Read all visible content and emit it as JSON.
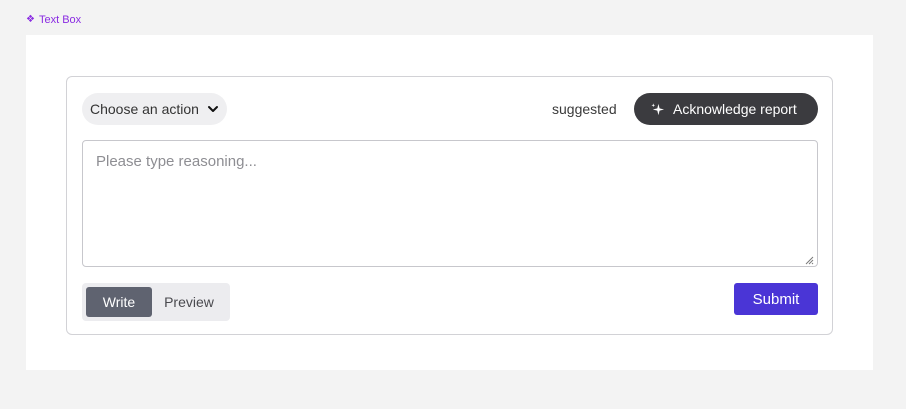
{
  "frame": {
    "label": "Text Box",
    "label_color": "#8a2be2"
  },
  "toolbar": {
    "action_select": {
      "selected": "Choose an action"
    },
    "suggested_label": "suggested",
    "acknowledge_button": "Acknowledge report"
  },
  "reasoning": {
    "placeholder": "Please type reasoning...",
    "value": ""
  },
  "tabs": [
    {
      "label": "Write",
      "active": true
    },
    {
      "label": "Preview",
      "active": false
    }
  ],
  "submit_label": "Submit",
  "colors": {
    "accent": "#4a35d6",
    "dark_button": "#3b3b3f",
    "active_tab": "#5f6370"
  },
  "icons": {
    "frame": "component-diamond-icon",
    "select": "chevron-down-icon",
    "acknowledge": "sparkle-icon"
  }
}
